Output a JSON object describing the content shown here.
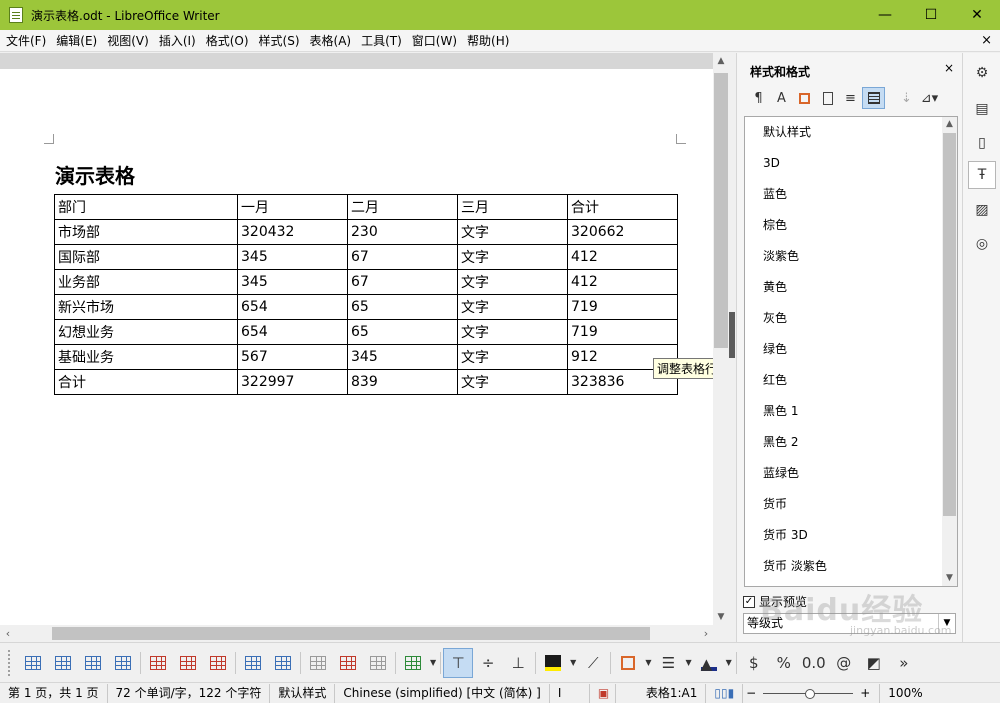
{
  "window": {
    "title": "演示表格.odt - LibreOffice Writer",
    "minimize_glyph": "—",
    "maximize_glyph": "☐",
    "close_glyph": "✕",
    "titlebar_color": "#9cc63a"
  },
  "menu": {
    "items": [
      "文件(F)",
      "编辑(E)",
      "视图(V)",
      "插入(I)",
      "格式(O)",
      "样式(S)",
      "表格(A)",
      "工具(T)",
      "窗口(W)",
      "帮助(H)"
    ],
    "close_doc_glyph": "×"
  },
  "document": {
    "heading": "演示表格",
    "table": [
      [
        "部门",
        "一月",
        "二月",
        "三月",
        "合计"
      ],
      [
        "市场部",
        "320432",
        "230",
        "文字",
        "320662"
      ],
      [
        "国际部",
        "345",
        "67",
        "文字",
        "412"
      ],
      [
        "业务部",
        "345",
        "67",
        "文字",
        "412"
      ],
      [
        "新兴市场",
        "654",
        "65",
        "文字",
        "719"
      ],
      [
        "幻想业务",
        "654",
        "65",
        "文字",
        "719"
      ],
      [
        "基础业务",
        "567",
        "345",
        "文字",
        "912"
      ],
      [
        "合计",
        "322997",
        "839",
        "文字",
        "323836"
      ]
    ],
    "tooltip": "调整表格行"
  },
  "sidebar": {
    "title": "样式和格式",
    "close_glyph": "×",
    "styles": [
      "默认样式",
      "3D",
      "蓝色",
      "棕色",
      "淡紫色",
      "黄色",
      "灰色",
      "绿色",
      "红色",
      "黑色 1",
      "黑色 2",
      "蓝绿色",
      "货币",
      "货币 3D",
      "货币 淡紫色"
    ],
    "show_preview_label": "显示预览",
    "show_preview_checked": true,
    "filter_value": "等级式"
  },
  "statusbar": {
    "page": "第 1 页，共 1 页",
    "words": "72 个单词/字，122 个字符",
    "page_style": "默认样式",
    "language": "Chinese (simplified) [中文 (简体) ]",
    "selection_mode_glyph": "I",
    "table_cell": "表格1:A1",
    "zoom_minus": "−",
    "zoom_plus": "+",
    "zoom": "100%"
  },
  "watermark": {
    "text": "Baidu经验",
    "subtext": "jingyan.baidu.com"
  }
}
